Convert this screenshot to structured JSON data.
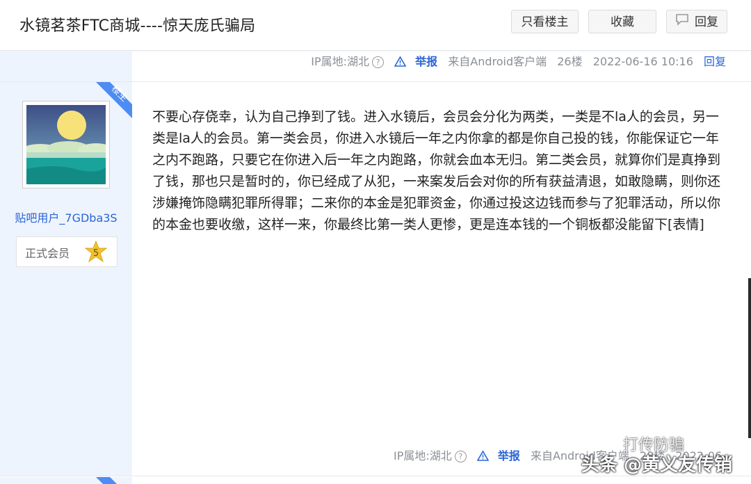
{
  "header": {
    "title": "水镜茗茶FTC商城----惊天庞氏骗局",
    "buttons": {
      "only_op": "只看楼主",
      "favorite": "收藏",
      "reply": "回复"
    }
  },
  "prev_post_meta": {
    "ip": "IP属地:湖北",
    "help": "?",
    "report": "举报",
    "client": "来自Android客户端",
    "floor": "26楼",
    "time": "2022-06-16 10:16",
    "reply": "回复"
  },
  "post": {
    "op_tag": "楼主",
    "user": {
      "name": "贴吧用户_7GDba3S",
      "level_label": "正式会员",
      "level": "5"
    },
    "content": "不要心存侥幸，认为自己挣到了钱。进入水镜后，会员会分化为两类，一类是不la人的会员，另一类是la人的会员。第一类会员，你进入水镜后一年之内你拿的都是你自己投的钱，你能保证它一年之内不跑路，只要它在你进入后一年之内跑路，你就会血本无归。第二类会员，就算你们是真挣到了钱，那也只是暂时的，你已经成了从犯，一来案发后会对你的所有获益清退，如敢隐瞒，则你还涉嫌掩饰隐瞒犯罪所得罪；二来你的本金是犯罪资金，你通过投这边钱而参与了犯罪活动，所以你的本金也要收缴，这样一来，你最终比第一类人更惨，更是连本钱的一个铜板都没能留下[表情]",
    "meta": {
      "ip": "IP属地:湖北",
      "help": "?",
      "report": "举报",
      "client": "来自Android客户端",
      "floor": "28楼",
      "time": "2022-06-"
    }
  },
  "next_post": {
    "op_tag": "楼主"
  },
  "watermark": {
    "main": "头条 @黄义友传销",
    "sub": "打传防骗"
  },
  "colors": {
    "accent": "#2a64d8",
    "sidebar": "#eef4fd",
    "op_tag": "#4e8cf5"
  }
}
